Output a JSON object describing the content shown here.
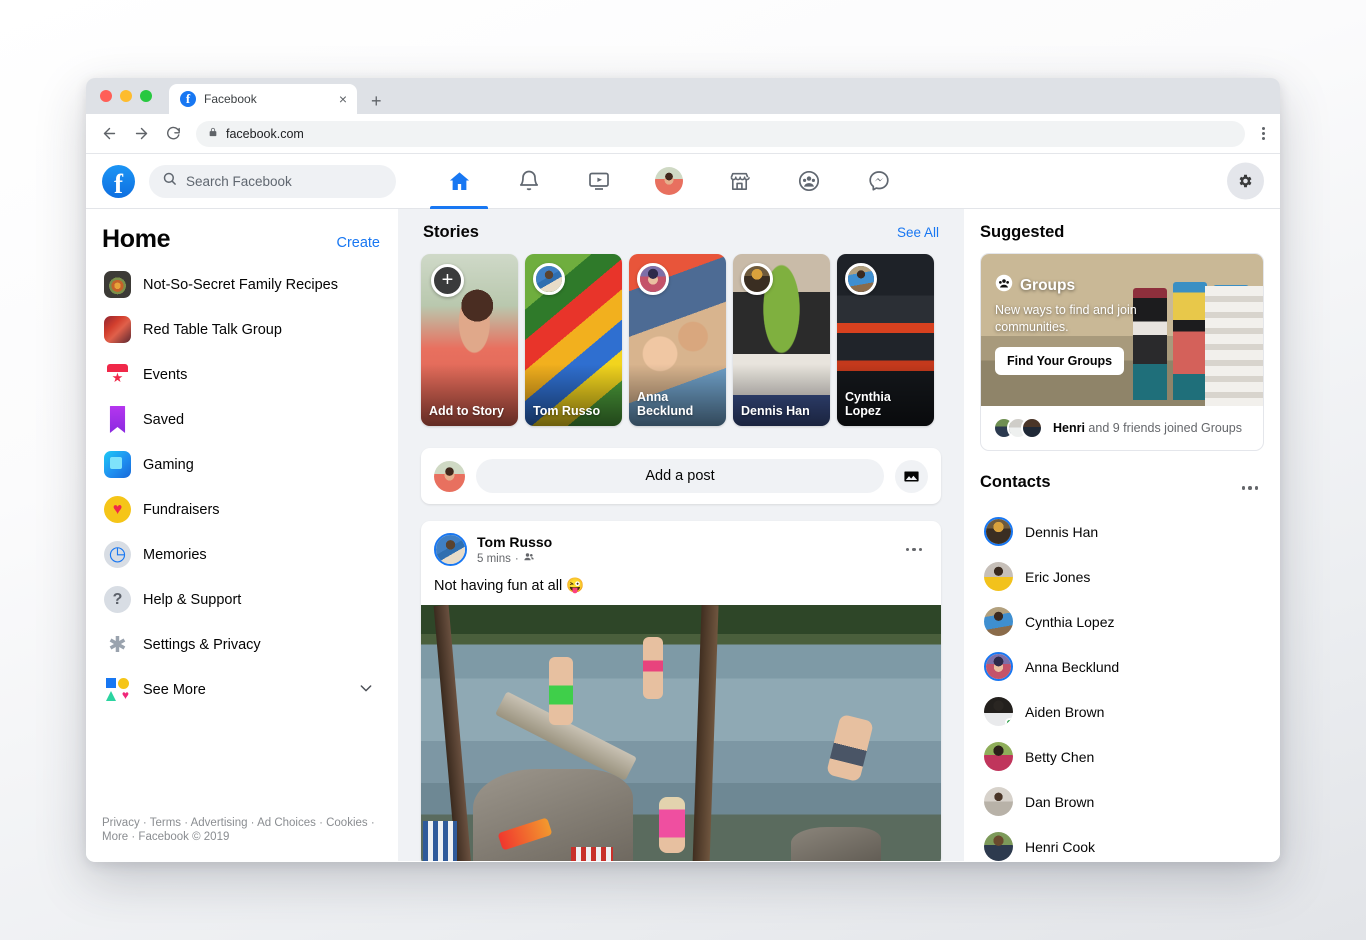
{
  "browser": {
    "tab_title": "Facebook",
    "tab_favicon": "f",
    "close_icon": "×",
    "newtab_icon": "+",
    "back_icon": "←",
    "forward_icon": "→",
    "reload_icon": "⟳",
    "lock_icon": "🔒",
    "url": "facebook.com",
    "menu_icon": "browser-menu-icon"
  },
  "header": {
    "logo": "f",
    "search_placeholder": "Search Facebook",
    "search_icon": "search-icon",
    "nav": [
      {
        "name": "home",
        "label": "Home",
        "icon": "home-icon",
        "active": true
      },
      {
        "name": "notifications",
        "label": "Notifications",
        "icon": "bell-icon",
        "active": false
      },
      {
        "name": "watch",
        "label": "Watch",
        "icon": "video-icon",
        "active": false
      },
      {
        "name": "profile",
        "label": "Profile",
        "icon": "avatar-icon",
        "active": false
      },
      {
        "name": "marketplace",
        "label": "Marketplace",
        "icon": "shop-icon",
        "active": false
      },
      {
        "name": "groups",
        "label": "Groups",
        "icon": "groups-icon",
        "active": false
      },
      {
        "name": "messenger",
        "label": "Messenger",
        "icon": "messenger-icon",
        "active": false
      }
    ],
    "settings_icon": "gear-icon",
    "accent_color": "#1877f2"
  },
  "sidebar": {
    "title": "Home",
    "create_label": "Create",
    "items": [
      {
        "label": "Not-So-Secret Family Recipes",
        "icon": "group-photo-icon"
      },
      {
        "label": "Red Table Talk Group",
        "icon": "group-photo-icon"
      },
      {
        "label": "Events",
        "icon": "calendar-icon"
      },
      {
        "label": "Saved",
        "icon": "bookmark-icon"
      },
      {
        "label": "Gaming",
        "icon": "gaming-icon"
      },
      {
        "label": "Fundraisers",
        "icon": "heart-icon"
      },
      {
        "label": "Memories",
        "icon": "clock-icon"
      },
      {
        "label": "Help & Support",
        "icon": "question-icon"
      },
      {
        "label": "Settings & Privacy",
        "icon": "gear-icon"
      },
      {
        "label": "See More",
        "icon": "shapes-icon",
        "chevron": "chevron-down-icon"
      }
    ],
    "footer": "Privacy · Terms · Advertising · Ad Choices · Cookies · More · Facebook © 2019"
  },
  "stories": {
    "heading": "Stories",
    "see_all": "See All",
    "add_icon": "plus-icon",
    "items": [
      {
        "name": "Add to Story",
        "type": "add",
        "art": "ph-girl"
      },
      {
        "name": "Tom Russo",
        "type": "story",
        "art": "ph-pinata",
        "avatar": "ph-tom"
      },
      {
        "name": "Anna Becklund",
        "type": "story",
        "art": "ph-two",
        "avatar": "ph-anna"
      },
      {
        "name": "Dennis Han",
        "type": "story",
        "art": "ph-plant",
        "avatar": "ph-dennis"
      },
      {
        "name": "Cynthia Lopez",
        "type": "story",
        "art": "ph-market",
        "avatar": "ph-cynthia"
      }
    ]
  },
  "composer": {
    "placeholder": "Add a post",
    "photo_icon": "photo-icon",
    "avatar": "ph-me"
  },
  "post": {
    "author": "Tom Russo",
    "time": "5 mins",
    "audience_icon": "friends-icon",
    "menu_icon": "more-options-icon",
    "text": "Not having fun at all 😜",
    "image": "lake-jump-photo"
  },
  "suggested": {
    "heading": "Suggested",
    "card_icon": "groups-icon",
    "card_title": "Groups",
    "card_subtitle": "New ways to find and join communities.",
    "card_button": "Find Your Groups",
    "footer_name": "Henri",
    "footer_rest": " and 9 friends joined Groups"
  },
  "contacts": {
    "heading": "Contacts",
    "menu_icon": "more-options-icon",
    "items": [
      {
        "name": "Dennis Han",
        "art": "ph-dennis",
        "story_ring": true,
        "online": false
      },
      {
        "name": "Eric Jones",
        "art": "ph-eric",
        "story_ring": false,
        "online": false
      },
      {
        "name": "Cynthia Lopez",
        "art": "ph-cynthia",
        "story_ring": false,
        "online": false
      },
      {
        "name": "Anna Becklund",
        "art": "ph-anna",
        "story_ring": true,
        "online": false
      },
      {
        "name": "Aiden Brown",
        "art": "ph-aiden",
        "story_ring": false,
        "online": true
      },
      {
        "name": "Betty Chen",
        "art": "ph-betty",
        "story_ring": false,
        "online": false
      },
      {
        "name": "Dan Brown",
        "art": "ph-dan",
        "story_ring": false,
        "online": false
      },
      {
        "name": "Henri Cook",
        "art": "ph-henri",
        "story_ring": false,
        "online": false
      }
    ]
  }
}
